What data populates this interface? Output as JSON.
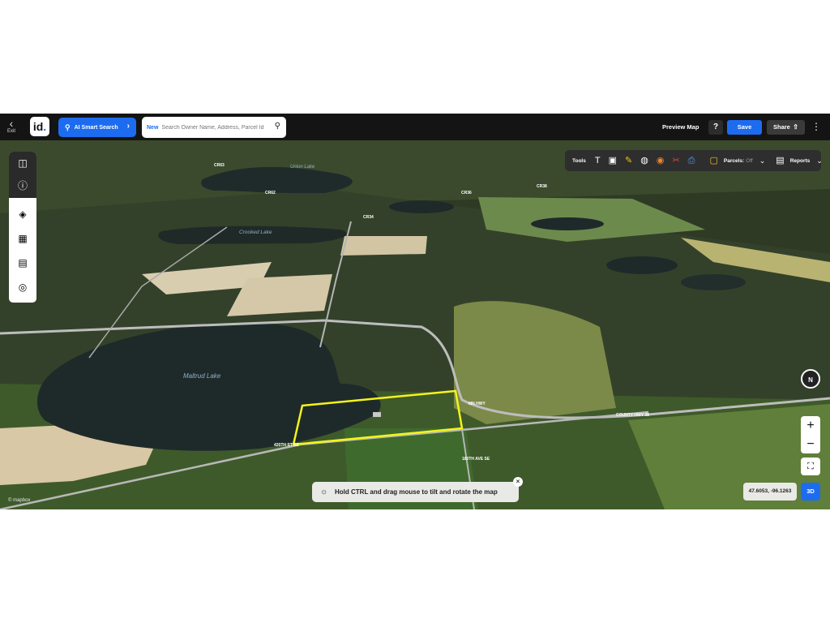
{
  "header": {
    "exit_label": "Exit",
    "logo_text": "id",
    "ai_search_label": "AI Smart Search",
    "search_badge": "New",
    "search_placeholder": "Search Owner Name, Address, Parcel Id",
    "preview_label": "Preview Map",
    "help_label": "?",
    "save_label": "Save",
    "share_label": "Share"
  },
  "tools": {
    "label": "Tools",
    "parcels_label": "Parcels:",
    "parcels_state": "Off",
    "reports_label": "Reports"
  },
  "map": {
    "lakes": [
      "Union Lake",
      "Crooked Lake",
      "Maltrud Lake"
    ],
    "roads": [
      "CR63",
      "CR62",
      "CR34",
      "CR36",
      "CR38",
      "420TH ST SE",
      "COUNTY HWY 38",
      "MN HWY",
      "180TH AVE SE"
    ],
    "attribution": "© mapbox"
  },
  "controls": {
    "compass_label": "N",
    "zoom_in": "+",
    "zoom_out": "−",
    "coordinates": "47.6053, -96.1263",
    "mode_label": "3D"
  },
  "hint": {
    "text": "Hold CTRL and drag mouse to tilt and rotate the map"
  },
  "colors": {
    "accent": "#1d6cf0",
    "parcel_outline": "#f4f41a",
    "topbar": "#141414"
  }
}
